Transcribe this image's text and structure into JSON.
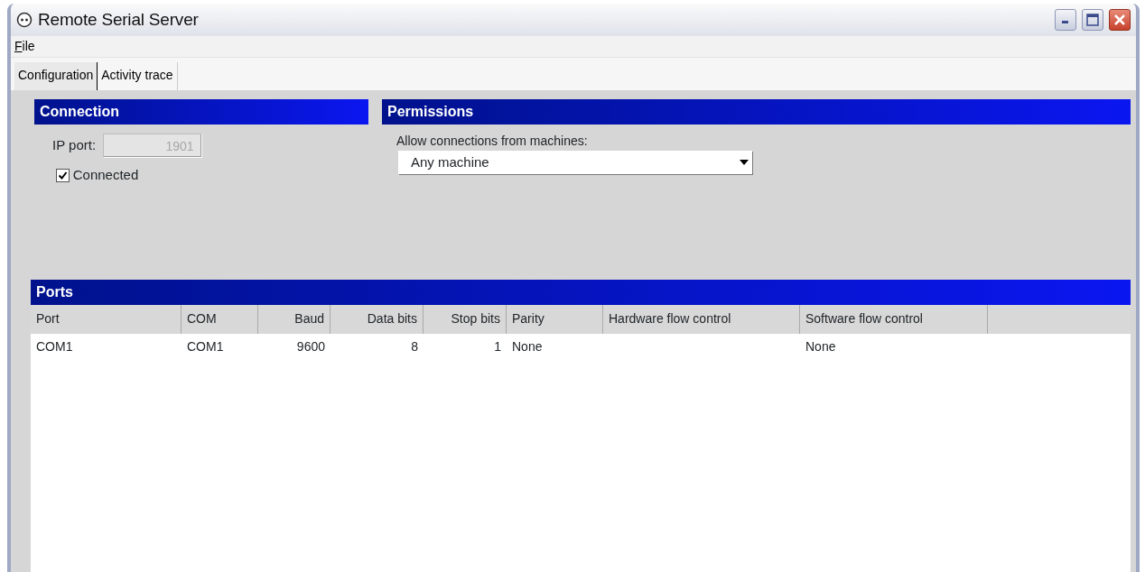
{
  "window": {
    "title": "Remote Serial Server"
  },
  "menu": [
    {
      "label": "File"
    }
  ],
  "tabs": [
    {
      "label": "Configuration",
      "selected": true
    },
    {
      "label": "Activity trace",
      "selected": false
    }
  ],
  "connection": {
    "title": "Connection",
    "ip_port_label": "IP port:",
    "ip_port_value": "1901",
    "ip_port_disabled": true,
    "connected_label": "Connected",
    "connected_checked": true
  },
  "permissions": {
    "title": "Permissions",
    "label": "Allow connections from machines:",
    "value": "Any machine"
  },
  "ports": {
    "title": "Ports",
    "columns": [
      {
        "label": "Port"
      },
      {
        "label": "COM"
      },
      {
        "label": "Baud"
      },
      {
        "label": "Data bits"
      },
      {
        "label": "Stop bits"
      },
      {
        "label": "Parity"
      },
      {
        "label": "Hardware flow control"
      },
      {
        "label": "Software flow control"
      }
    ],
    "rows": [
      {
        "cells": [
          "COM1",
          "COM1",
          "9600",
          "8",
          "1",
          "None",
          null,
          "None"
        ]
      }
    ]
  }
}
